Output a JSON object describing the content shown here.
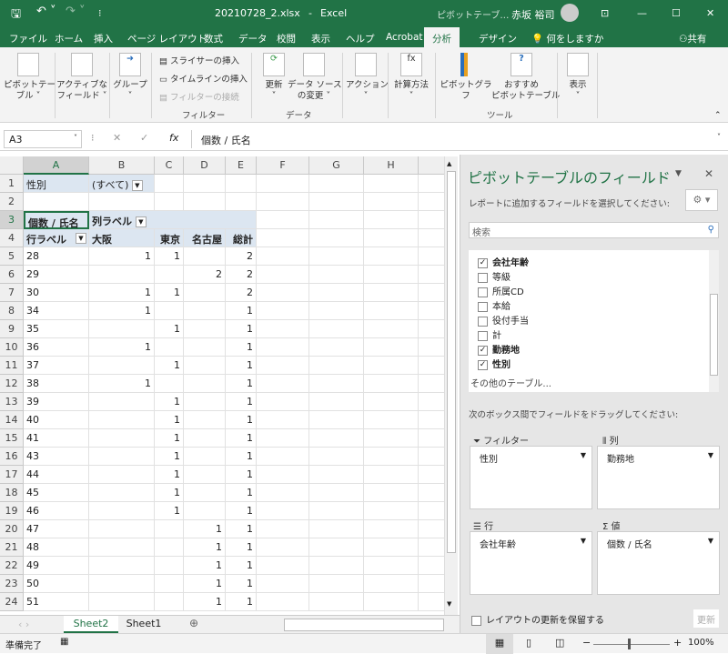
{
  "title": {
    "filename": "20210728_2.xlsx",
    "sep": "-",
    "app": "Excel",
    "context": "ピボットテーブ…",
    "user": "赤坂 裕司"
  },
  "menu": [
    "ファイル",
    "ホーム",
    "挿入",
    "ページ レイアウト",
    "数式",
    "データ",
    "校閲",
    "表示",
    "ヘルプ",
    "Acrobat",
    "分析",
    "デザイン"
  ],
  "menu_active": "分析",
  "tell_me": "何をしますか",
  "share": "共有",
  "ribbon": {
    "pivot_table": "ピボットテー\nブル ˅",
    "active_field": "アクティブな\nフィールド ˅",
    "group": "グループ\n˅",
    "slicer": "スライサーの挿入",
    "timeline": "タイムラインの挿入",
    "filter_conn": "フィルターの接続",
    "filter_group": "フィルター",
    "refresh": "更新\n˅",
    "change_source": "データ ソース\nの変更 ˅",
    "data_group": "データ",
    "actions": "アクション\n˅",
    "calculations": "計算方法\n˅",
    "pivot_chart": "ピボットグラフ",
    "recommended": "おすすめ\nピボットテーブル",
    "tools_group": "ツール",
    "show": "表示\n˅"
  },
  "formula": {
    "name_box": "A3",
    "fx": "fx",
    "value": "個数 / 氏名"
  },
  "columns": [
    "A",
    "B",
    "C",
    "D",
    "E",
    "F",
    "G",
    "H"
  ],
  "pivot": {
    "filter_label": "性別",
    "filter_value": "(すべて)",
    "values_label": "個数 / 氏名",
    "col_labels": "列ラベル",
    "row_labels": "行ラベル",
    "col_headers": [
      "大阪",
      "東京",
      "名古屋",
      "総計"
    ],
    "rows": [
      [
        "28",
        "1",
        "1",
        "",
        "2"
      ],
      [
        "29",
        "",
        "",
        "2",
        "2"
      ],
      [
        "30",
        "1",
        "1",
        "",
        "2"
      ],
      [
        "34",
        "1",
        "",
        "",
        "1"
      ],
      [
        "35",
        "",
        "1",
        "",
        "1"
      ],
      [
        "36",
        "1",
        "",
        "",
        "1"
      ],
      [
        "37",
        "",
        "1",
        "",
        "1"
      ],
      [
        "38",
        "1",
        "",
        "",
        "1"
      ],
      [
        "39",
        "",
        "1",
        "",
        "1"
      ],
      [
        "40",
        "",
        "1",
        "",
        "1"
      ],
      [
        "41",
        "",
        "1",
        "",
        "1"
      ],
      [
        "43",
        "",
        "1",
        "",
        "1"
      ],
      [
        "44",
        "",
        "1",
        "",
        "1"
      ],
      [
        "45",
        "",
        "1",
        "",
        "1"
      ],
      [
        "46",
        "",
        "1",
        "",
        "1"
      ],
      [
        "47",
        "",
        "",
        "1",
        "1"
      ],
      [
        "48",
        "",
        "",
        "1",
        "1"
      ],
      [
        "49",
        "",
        "",
        "1",
        "1"
      ],
      [
        "50",
        "",
        "",
        "1",
        "1"
      ],
      [
        "51",
        "",
        "",
        "1",
        "1"
      ]
    ]
  },
  "sheets": [
    "Sheet2",
    "Sheet1"
  ],
  "active_sheet": "Sheet2",
  "pane": {
    "title": "ピボットテーブルのフィールド",
    "choose": "レポートに追加するフィールドを選択してください:",
    "search_placeholder": "検索",
    "fields": [
      {
        "label": "会社年齢",
        "checked": true
      },
      {
        "label": "等級",
        "checked": false
      },
      {
        "label": "所属CD",
        "checked": false
      },
      {
        "label": "本給",
        "checked": false
      },
      {
        "label": "役付手当",
        "checked": false
      },
      {
        "label": "計",
        "checked": false
      },
      {
        "label": "勤務地",
        "checked": true
      },
      {
        "label": "性別",
        "checked": true
      }
    ],
    "more_tables": "その他のテーブル...",
    "drag": "次のボックス間でフィールドをドラッグしてください:",
    "filters_label": "フィルター",
    "filters_value": "性別",
    "columns_label": "列",
    "columns_value": "勤務地",
    "rows_label": "行",
    "rows_value": "会社年齢",
    "values_label": "値",
    "values_value": "個数 / 氏名",
    "defer": "レイアウトの更新を保留する",
    "update": "更新"
  },
  "status": {
    "ready": "準備完了",
    "zoom": "100%"
  },
  "colors": {
    "excel_green": "#217346",
    "pivot_header": "#dce6f1"
  }
}
